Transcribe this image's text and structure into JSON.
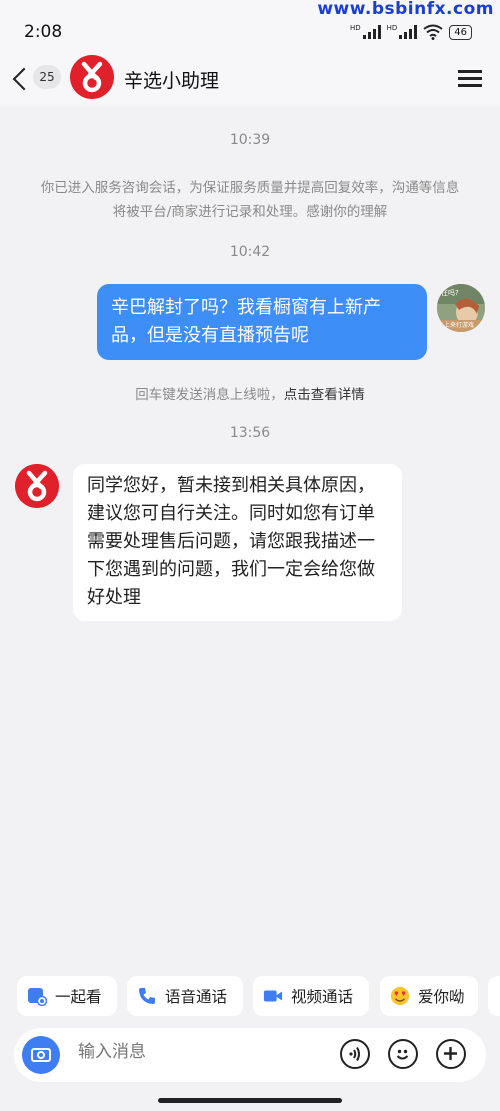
{
  "status_bar": {
    "time": "2:08",
    "watermark": "www.bsbinfx.com",
    "network_1": "HD",
    "network_2": "HD",
    "battery": "46"
  },
  "header": {
    "unread_count": "25",
    "title": "辛选小助理",
    "brand_color": "#e0202a"
  },
  "chat": {
    "messages": [
      {
        "type": "timestamp",
        "text": "10:39"
      },
      {
        "type": "system",
        "text": "你已进入服务咨询会话，为保证服务质量并提高回复效率，沟通等信息将被平台/商家进行记录和处理。感谢你的理解"
      },
      {
        "type": "timestamp",
        "text": "10:42"
      },
      {
        "type": "outgoing",
        "text": "辛巴解封了吗？我看橱窗有上新产品，但是没有直播预告呢",
        "avatar_overlay_top": "在吗?",
        "avatar_overlay_bottom": "上来打游戏"
      },
      {
        "type": "hint",
        "text": "回车键发送消息上线啦，",
        "link": "点击查看详情"
      },
      {
        "type": "timestamp",
        "text": "13:56"
      },
      {
        "type": "incoming",
        "text": "同学您好，暂未接到相关具体原因，建议您可自行关注。同时如您有订单需要处理售后问题，请您跟我描述一下您遇到的问题，我们一定会给您做好处理"
      }
    ],
    "outgoing_bubble_color": "#3e8ef7"
  },
  "quick_actions": [
    {
      "label": "一起看",
      "icon": "watch-together-icon"
    },
    {
      "label": "语音通话",
      "icon": "phone-icon"
    },
    {
      "label": "视频通话",
      "icon": "video-camera-icon"
    },
    {
      "label": "爱你呦",
      "icon": "heart-eyes-emoji-icon"
    }
  ],
  "input": {
    "placeholder": "输入消息"
  }
}
